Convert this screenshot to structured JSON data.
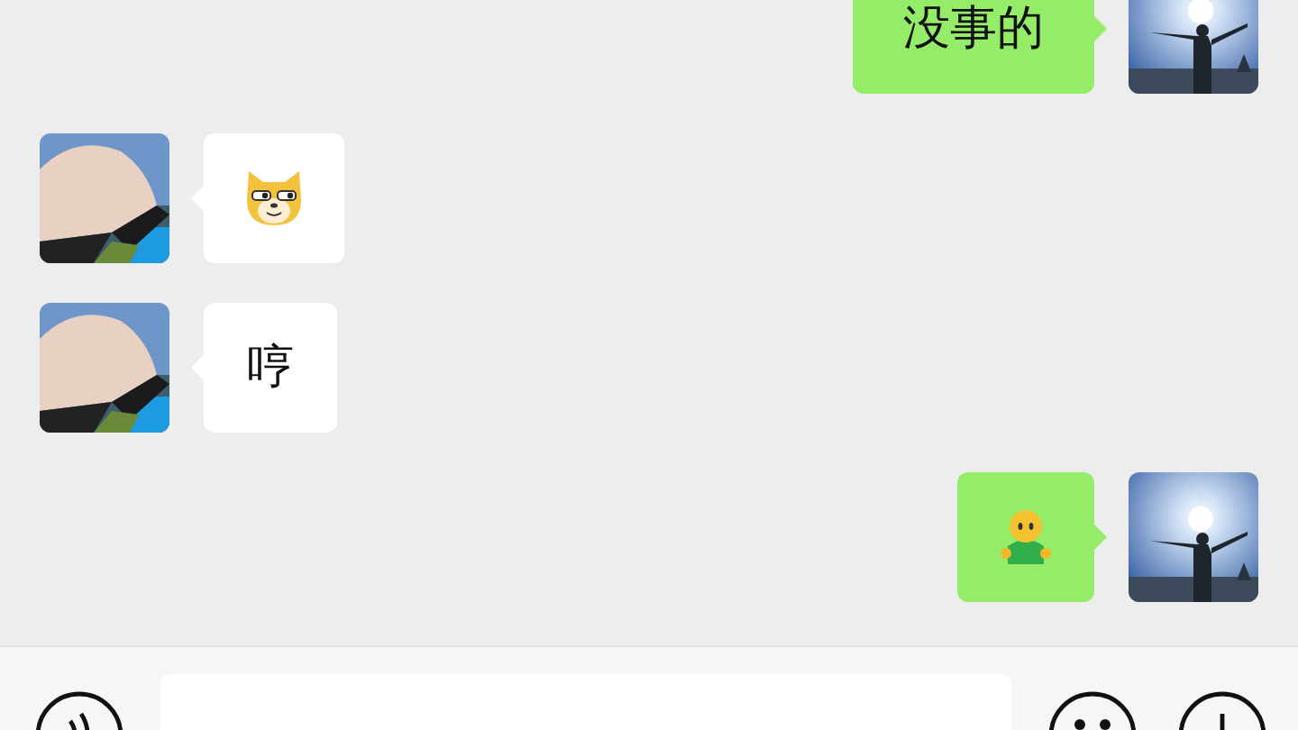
{
  "messages": [
    {
      "outgoing": true,
      "kind": "text",
      "text": "没事的"
    },
    {
      "outgoing": false,
      "kind": "sticker"
    },
    {
      "outgoing": false,
      "kind": "text",
      "text": "哼"
    },
    {
      "outgoing": true,
      "kind": "sticker"
    }
  ]
}
